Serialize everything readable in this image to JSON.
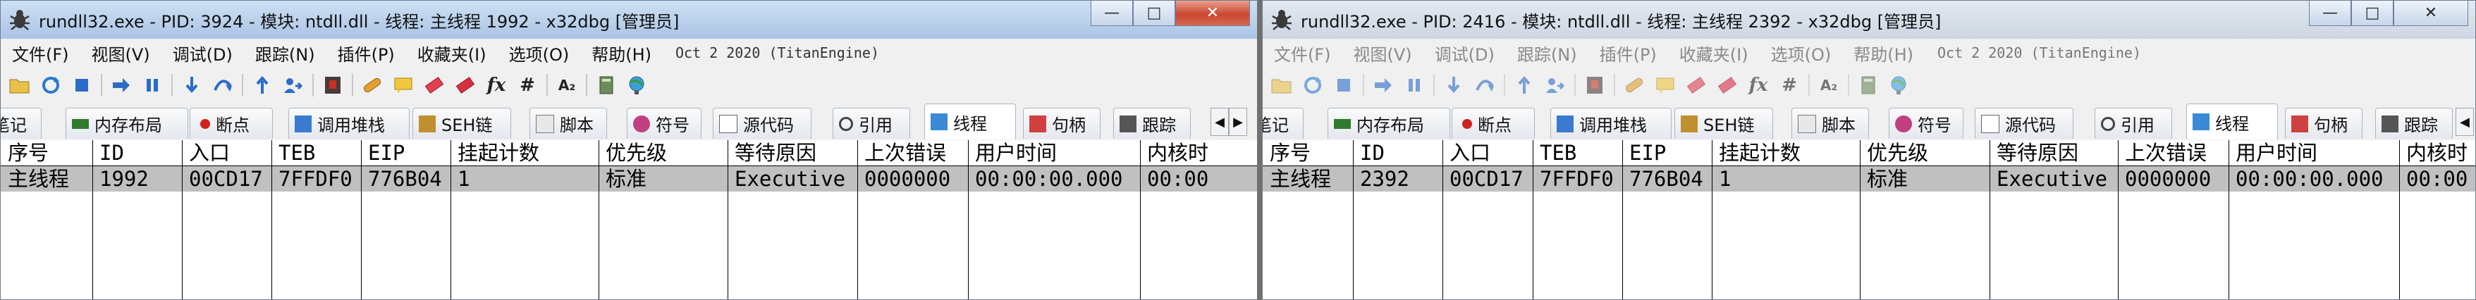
{
  "colors": {
    "active_title_gradient": "#bcd2ec",
    "inactive_title_gradient": "#d7dfe9",
    "selected_row": "#c0c0c0",
    "close_button": "#c9482f",
    "grid_line": "#000000"
  },
  "menu_items": [
    "文件(F)",
    "视图(V)",
    "调试(D)",
    "跟踪(N)",
    "插件(P)",
    "收藏夹(I)",
    "选项(O)",
    "帮助(H)"
  ],
  "build_date": "Oct 2 2020 (TitanEngine)",
  "toolbar_icons": [
    "open-folder-icon",
    "restart-icon",
    "stop-icon",
    "run-icon",
    "pause-icon",
    "step-into-icon",
    "step-over-icon",
    "execute-till-return-icon",
    "run-to-user-code-icon",
    "script-icon",
    "patch-icon",
    "comment-icon",
    "label-icon",
    "bookmark-icon",
    "function-icon",
    "hash-icon",
    "font-icon",
    "settings-icon",
    "globe-icon"
  ],
  "toolbar_glyphs": {
    "fx": "fx",
    "hash": "#",
    "font": "A₂"
  },
  "tabs": [
    "笔记",
    "内存布局",
    "断点",
    "调用堆栈",
    "SEH链",
    "脚本",
    "符号",
    "源代码",
    "引用",
    "线程",
    "句柄",
    "跟踪"
  ],
  "columns": [
    "序号",
    "ID",
    "入口",
    "TEB",
    "EIP",
    "挂起计数",
    "优先级",
    "等待原因",
    "上次错误",
    "用户时间",
    "内核时"
  ],
  "windows": [
    {
      "title": "rundll32.exe - PID: 3924 - 模块: ntdll.dll - 线程: 主线程 1992 - x32dbg [管理员]",
      "active": true,
      "row": [
        "主线程",
        "1992",
        "00CD17",
        "7FFDF0",
        "776B04",
        "1",
        "标准",
        "Executive",
        "0000000",
        "00:00:00.000",
        "00:00"
      ]
    },
    {
      "title": "rundll32.exe - PID: 2416 - 模块: ntdll.dll - 线程: 主线程 2392 - x32dbg [管理员]",
      "active": false,
      "row": [
        "主线程",
        "2392",
        "00CD17",
        "7FFDF0",
        "776B04",
        "1",
        "标准",
        "Executive",
        "0000000",
        "00:00:00.000",
        "00:00"
      ]
    }
  ],
  "window_buttons": {
    "minimize": "—",
    "maximize": "□",
    "close": "✕"
  },
  "tab_scroll": {
    "left": "◀",
    "right": "▶"
  }
}
